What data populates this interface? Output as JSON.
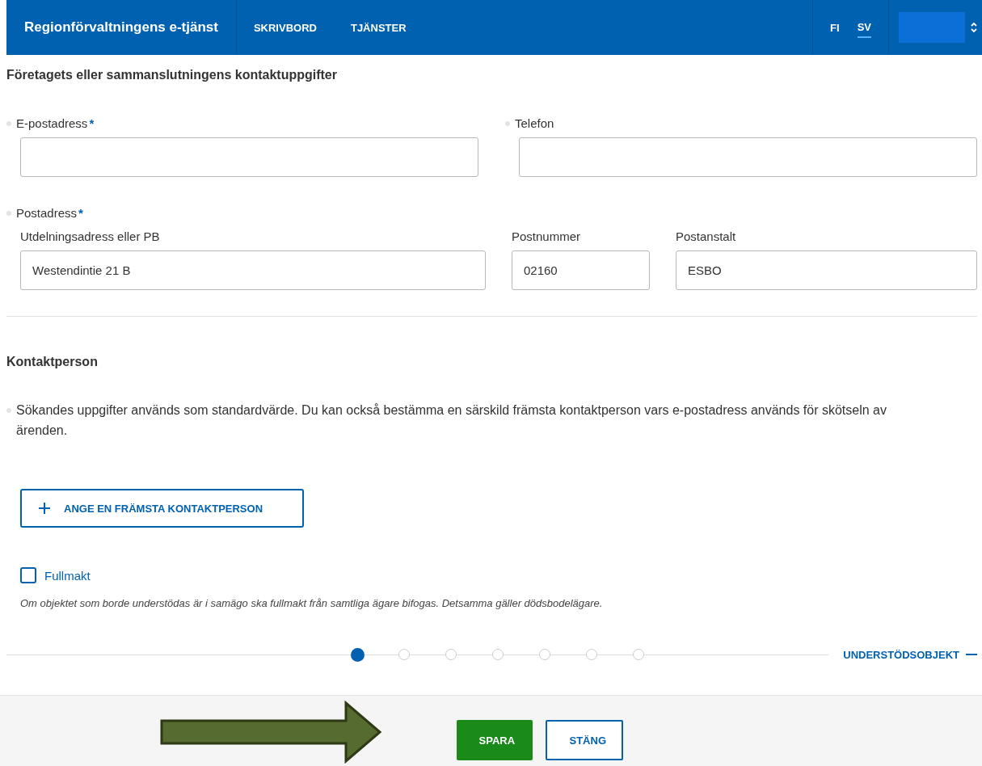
{
  "header": {
    "title": "Regionförvaltningens e-tjänst",
    "nav": [
      {
        "label": "SKRIVBORD"
      },
      {
        "label": "TJÄNSTER"
      }
    ],
    "languages": [
      {
        "label": "FI",
        "selected": false
      },
      {
        "label": "SV",
        "selected": true
      }
    ]
  },
  "contact_section": {
    "heading": "Företagets eller sammanslutningens kontaktuppgifter",
    "email": {
      "label": "E-postadress",
      "required_mark": "*"
    },
    "phone": {
      "label": "Telefon"
    },
    "postal": {
      "label": "Postadress",
      "required_mark": "*",
      "fields": [
        {
          "label": "Utdelningsadress eller PB",
          "value": "Westendintie 21 B"
        },
        {
          "label": "Postnummer",
          "value": "02160"
        },
        {
          "label": "Postanstalt",
          "value": "ESBO"
        }
      ]
    }
  },
  "contact_person": {
    "heading": "Kontaktperson",
    "info": "Sökandes uppgifter används som standardvärde. Du kan också bestämma en särskild främsta kontaktperson vars e-postadress används för skötseln av ärenden.",
    "add_button": "ANGE EN FRÄMSTA KONTAKTPERSON"
  },
  "power_of_attorney": {
    "label": "Fullmakt",
    "checked": false,
    "note": "Om objektet som borde understödas är i samägo ska fullmakt från samtliga ägare bifogas. Detsamma gäller dödsbodelägare."
  },
  "stepper": {
    "steps": [
      {
        "selected": true
      },
      {
        "selected": false
      },
      {
        "selected": false
      },
      {
        "selected": false
      },
      {
        "selected": false
      },
      {
        "selected": false
      },
      {
        "selected": false
      }
    ],
    "next_label": "UNDERSTÖDSOBJEKT"
  },
  "footer": {
    "buttons": [
      {
        "label": "SPARA",
        "kind": "primary"
      },
      {
        "label": "STÄNG",
        "kind": "secondary"
      }
    ]
  }
}
